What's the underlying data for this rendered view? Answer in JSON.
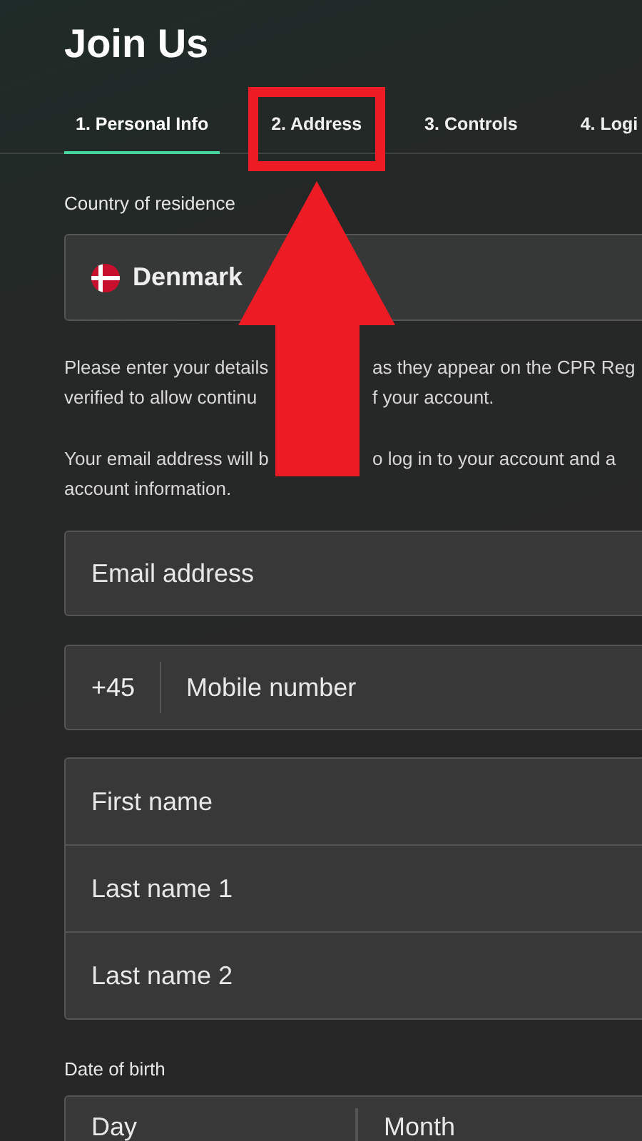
{
  "title": "Join Us",
  "tabs": [
    {
      "label": "1. Personal Info",
      "selected": true,
      "highlighted": false
    },
    {
      "label": "2. Address",
      "selected": false,
      "highlighted": true
    },
    {
      "label": "3. Controls",
      "selected": false,
      "highlighted": false
    },
    {
      "label": "4. Logi",
      "selected": false,
      "highlighted": false
    }
  ],
  "country": {
    "label": "Country of residence",
    "value": "Denmark"
  },
  "paragraphs": [
    {
      "lines": [
        {
          "fragments": [
            "Please enter your details",
            "as they appear on the CPR Reg"
          ]
        },
        {
          "fragments": [
            "verified to allow continu",
            "f your account."
          ]
        }
      ]
    },
    {
      "lines": [
        {
          "fragments": [
            "Your email address will b",
            "o log in to your account and a"
          ]
        },
        {
          "fragments": [
            "account information."
          ]
        }
      ]
    }
  ],
  "email": {
    "placeholder": "Email address"
  },
  "mobile": {
    "prefix": "+45",
    "placeholder": "Mobile number"
  },
  "names": [
    {
      "placeholder": "First name"
    },
    {
      "placeholder": "Last name 1"
    },
    {
      "placeholder": "Last name 2"
    }
  ],
  "date_of_birth": {
    "label": "Date of birth",
    "parts": [
      {
        "placeholder": "Day"
      },
      {
        "placeholder": "Month"
      }
    ]
  }
}
